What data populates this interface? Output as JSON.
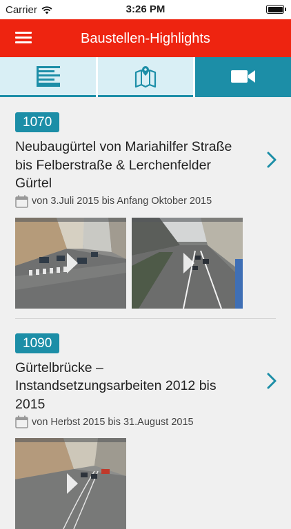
{
  "status_bar": {
    "carrier": "Carrier",
    "time": "3:26 PM"
  },
  "header": {
    "title": "Baustellen-Highlights",
    "menu_icon": "hamburger-icon"
  },
  "tabs": [
    {
      "icon": "list-icon",
      "active": false
    },
    {
      "icon": "map-icon",
      "active": false
    },
    {
      "icon": "video-camera-icon",
      "active": true
    }
  ],
  "colors": {
    "header": "#ee2410",
    "accent": "#1c8ea7",
    "tab_inactive": "#d9eff5"
  },
  "items": [
    {
      "badge": "1070",
      "title": "Neubaugürtel von Mariahilfer Straße bis Felberstraße & Lerchenfelder Gürtel",
      "date": "von 3.Juli 2015 bis Anfang Oktober 2015",
      "thumbnails": 2
    },
    {
      "badge": "1090",
      "title": "Gürtelbrücke – Instandsetzungsarbeiten 2012 bis 2015",
      "date": "von Herbst 2015 bis 31.August 2015",
      "thumbnails": 1
    }
  ]
}
